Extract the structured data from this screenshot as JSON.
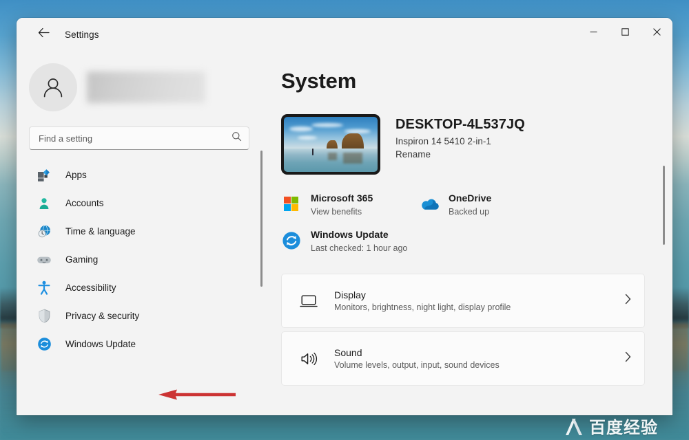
{
  "window": {
    "title": "Settings",
    "back_icon": "back-arrow-icon",
    "minimize_label": "—",
    "maximize_label": "□",
    "close_label": "✕"
  },
  "sidebar": {
    "profile": {
      "avatar_icon": "user-avatar-icon",
      "name_redacted": ""
    },
    "search": {
      "placeholder": "Find a setting",
      "value": "",
      "icon": "search-icon"
    },
    "items": [
      {
        "label": "Apps",
        "icon": "apps-icon",
        "selected": false
      },
      {
        "label": "Accounts",
        "icon": "accounts-icon",
        "selected": false
      },
      {
        "label": "Time & language",
        "icon": "time-language-icon",
        "selected": false
      },
      {
        "label": "Gaming",
        "icon": "gaming-icon",
        "selected": false
      },
      {
        "label": "Accessibility",
        "icon": "accessibility-icon",
        "selected": false
      },
      {
        "label": "Privacy & security",
        "icon": "shield-icon",
        "selected": false
      },
      {
        "label": "Windows Update",
        "icon": "windows-update-icon",
        "selected": false
      }
    ]
  },
  "main": {
    "page_title": "System",
    "device": {
      "thumbnail_icon": "device-wallpaper-thumbnail",
      "name": "DESKTOP-4L537JQ",
      "model": "Inspiron 14 5410 2-in-1",
      "rename_label": "Rename"
    },
    "services": [
      {
        "title": "Microsoft 365",
        "subtitle": "View benefits",
        "icon": "microsoft-logo-icon"
      },
      {
        "title": "OneDrive",
        "subtitle": "Backed up",
        "icon": "onedrive-cloud-icon"
      },
      {
        "title": "Windows Update",
        "subtitle": "Last checked: 1 hour ago",
        "icon": "windows-update-icon"
      }
    ],
    "cards": [
      {
        "title": "Display",
        "subtitle": "Monitors, brightness, night light, display profile",
        "icon": "monitor-icon",
        "chevron": "chevron-right-icon"
      },
      {
        "title": "Sound",
        "subtitle": "Volume levels, output, input, sound devices",
        "icon": "speaker-icon",
        "chevron": "chevron-right-icon"
      }
    ]
  },
  "annotation": {
    "arrow_color": "#cc3333",
    "points_to": "Windows Update"
  },
  "watermark": {
    "text": "百度经验",
    "logo_icon": "x-logo-icon"
  },
  "colors": {
    "accent": "#0078d4",
    "window_bg": "#f3f3f3",
    "card_bg": "#fbfbfb",
    "text_primary": "#1b1b1b",
    "text_secondary": "#5b5b5b"
  }
}
